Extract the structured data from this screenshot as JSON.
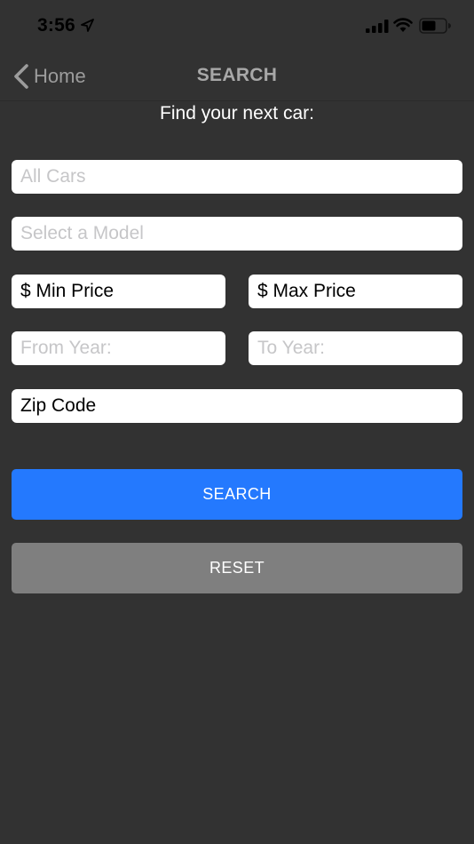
{
  "status_bar": {
    "time": "3:56",
    "icons": [
      "location-arrow-icon",
      "cellular-signal-icon",
      "wifi-icon",
      "battery-icon"
    ]
  },
  "nav": {
    "back_label": "Home",
    "title": "SEARCH"
  },
  "heading": "Find your next car:",
  "form": {
    "make": {
      "placeholder": "All Cars",
      "value": ""
    },
    "model": {
      "placeholder": "Select a Model",
      "value": ""
    },
    "min_price": {
      "placeholder": "$ Min Price",
      "value": ""
    },
    "max_price": {
      "placeholder": "$ Max Price",
      "value": ""
    },
    "from_year": {
      "placeholder": "From Year:",
      "value": ""
    },
    "to_year": {
      "placeholder": "To Year:",
      "value": ""
    },
    "zip_code": {
      "placeholder": "Zip Code",
      "value": ""
    }
  },
  "buttons": {
    "search": "SEARCH",
    "reset": "RESET"
  },
  "colors": {
    "background": "#323232",
    "search_button": "#2479fe",
    "reset_button": "#7f7f7f",
    "placeholder_light": "#c6c6c8"
  }
}
